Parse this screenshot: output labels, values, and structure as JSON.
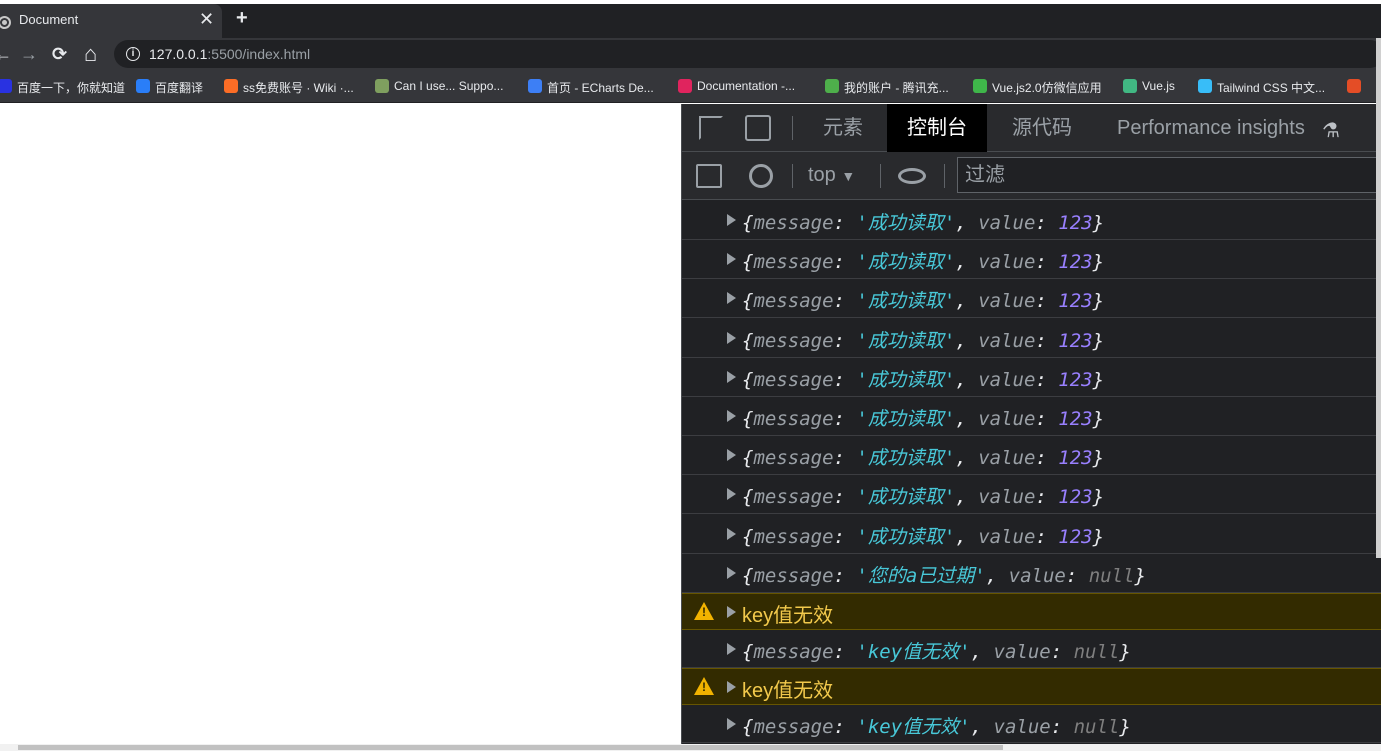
{
  "browser": {
    "tab_title": "Document",
    "tab_close": "✕",
    "new_tab": "+",
    "url_host": "127.0.0.1",
    "url_path": ":5500/index.html",
    "nav": {
      "back": "←",
      "forward": "→",
      "reload": "⟳",
      "home": "⌂"
    }
  },
  "bookmarks": [
    {
      "label": "百度一下，你就知道",
      "icon": "baidu-icon",
      "color": "#2932e1"
    },
    {
      "label": "百度翻译",
      "icon": "translate-icon",
      "color": "#2a7ef8"
    },
    {
      "label": "ss免费账号 · Wiki ·...",
      "icon": "gitlab-icon",
      "color": "#fc6d26"
    },
    {
      "label": "Can I use... Suppo...",
      "icon": "caniuse-icon",
      "color": "#7f9f5f"
    },
    {
      "label": "首页 - ECharts De...",
      "icon": "echarts-icon",
      "color": "#3d7ff5"
    },
    {
      "label": "Documentation -...",
      "icon": "documentation-icon",
      "color": "#e0245e"
    },
    {
      "label": "我的账户 - 腾讯充...",
      "icon": "tencent-icon",
      "color": "#4eaf4b"
    },
    {
      "label": "Vue.js2.0仿微信应用",
      "icon": "wechat-icon",
      "color": "#3fb64a"
    },
    {
      "label": "Vue.js",
      "icon": "vue-icon",
      "color": "#41b883"
    },
    {
      "label": "Tailwind CSS 中文...",
      "icon": "tailwind-icon",
      "color": "#38bdf8"
    },
    {
      "label": "",
      "icon": "c-icon",
      "color": "#e44d26"
    }
  ],
  "devtools": {
    "tabs": [
      "元素",
      "控制台",
      "源代码",
      "Performance insights"
    ],
    "active_tab": "控制台",
    "context": "top",
    "filter_placeholder": "过滤"
  },
  "console": {
    "rows": [
      {
        "kind": "log",
        "message": "'成功读取'",
        "value": "123",
        "value_type": "number"
      },
      {
        "kind": "log",
        "message": "'成功读取'",
        "value": "123",
        "value_type": "number"
      },
      {
        "kind": "log",
        "message": "'成功读取'",
        "value": "123",
        "value_type": "number"
      },
      {
        "kind": "log",
        "message": "'成功读取'",
        "value": "123",
        "value_type": "number"
      },
      {
        "kind": "log",
        "message": "'成功读取'",
        "value": "123",
        "value_type": "number"
      },
      {
        "kind": "log",
        "message": "'成功读取'",
        "value": "123",
        "value_type": "number"
      },
      {
        "kind": "log",
        "message": "'成功读取'",
        "value": "123",
        "value_type": "number"
      },
      {
        "kind": "log",
        "message": "'成功读取'",
        "value": "123",
        "value_type": "number"
      },
      {
        "kind": "log",
        "message": "'成功读取'",
        "value": "123",
        "value_type": "number"
      },
      {
        "kind": "log",
        "message": "'您的a已过期'",
        "value": "null",
        "value_type": "null"
      },
      {
        "kind": "warn",
        "text": "key值无效"
      },
      {
        "kind": "log",
        "message": "'key值无效'",
        "value": "null",
        "value_type": "null"
      },
      {
        "kind": "warn",
        "text": "key值无效"
      },
      {
        "kind": "log",
        "message": "'key值无效'",
        "value": "null",
        "value_type": "null"
      }
    ],
    "key_message": "message",
    "key_value": "value"
  }
}
